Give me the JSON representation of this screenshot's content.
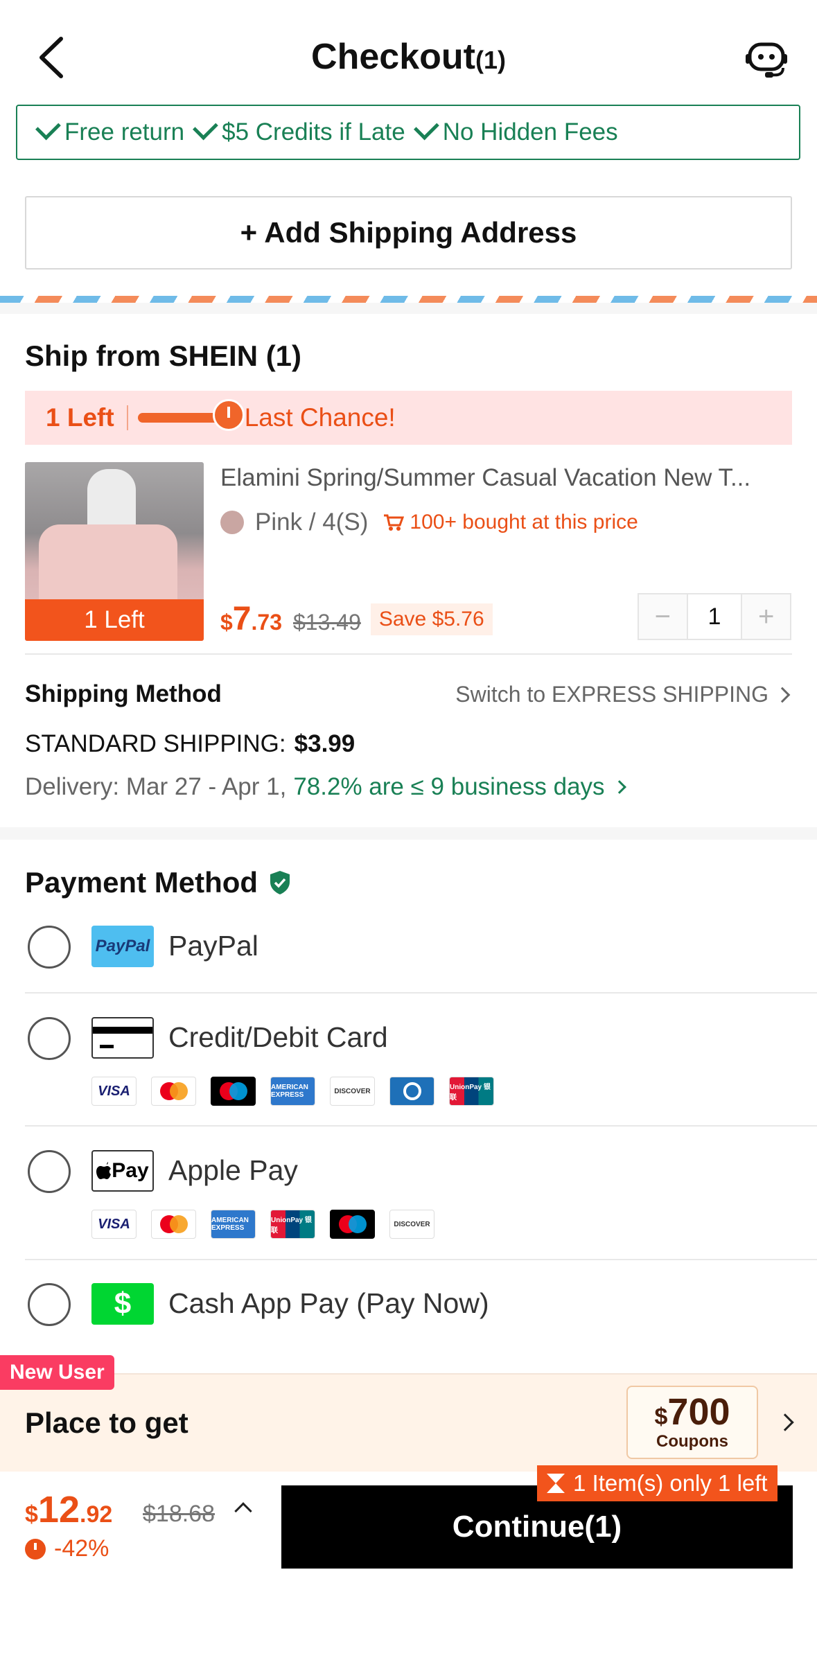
{
  "header": {
    "title": "Checkout",
    "count": "(1)"
  },
  "assurance": {
    "items": [
      "Free return",
      "$5 Credits if Late",
      "No Hidden Fees"
    ]
  },
  "address": {
    "button_label": "+ Add Shipping Address"
  },
  "shipment": {
    "title": "Ship from SHEIN (1)",
    "stock_count": "1 Left",
    "last_chance": "Last Chance!",
    "product": {
      "image_badge": "1 Left",
      "name": "Elamini Spring/Summer Casual Vacation New T...",
      "attributes": "Pink / 4(S)",
      "bought": "100+ bought at this price",
      "price_currency": "$",
      "price_whole": "7",
      "price_decimal": ".73",
      "old_price": "$13.49",
      "save": "Save $5.76",
      "quantity": "1",
      "minus": "−",
      "plus": "+"
    },
    "shipping_method_label": "Shipping Method",
    "switch_label": "Switch to EXPRESS SHIPPING",
    "standard_label": "STANDARD SHIPPING:",
    "standard_price": "$3.99",
    "delivery_prefix": "Delivery: Mar 27 - Apr 1,",
    "delivery_rate": "78.2% are ≤ 9 business days"
  },
  "payment": {
    "title": "Payment Method",
    "options": [
      {
        "label": "PayPal",
        "logo_text": "PayPal"
      },
      {
        "label": "Credit/Debit Card"
      },
      {
        "label": "Apple Pay",
        "logo_text": " Pay"
      },
      {
        "label": "Cash App Pay (Pay Now)",
        "logo_text": "$"
      }
    ],
    "card_brands": [
      "VISA",
      "mastercard",
      "maestro",
      "AMERICAN EXPRESS",
      "DISCOVER",
      "Diners Club",
      "UnionPay 银联"
    ],
    "applepay_brands": [
      "VISA",
      "mastercard",
      "AMERICAN EXPRESS",
      "UnionPay 银联",
      "maestro",
      "DISCOVER"
    ]
  },
  "new_user": {
    "tag": "New User",
    "text": "Place to get",
    "coupon_currency": "$",
    "coupon_amount": "700",
    "coupon_label": "Coupons"
  },
  "summary": {
    "currency": "$",
    "total_whole": "12",
    "total_decimal": ".92",
    "old_total": "$18.68",
    "discount": "-42%",
    "continue_label": "Continue(1)",
    "stock_tip": "1 Item(s) only 1 left"
  },
  "colors": {
    "accent": "#ea4f16",
    "green": "#198055",
    "cta": "#000000"
  }
}
